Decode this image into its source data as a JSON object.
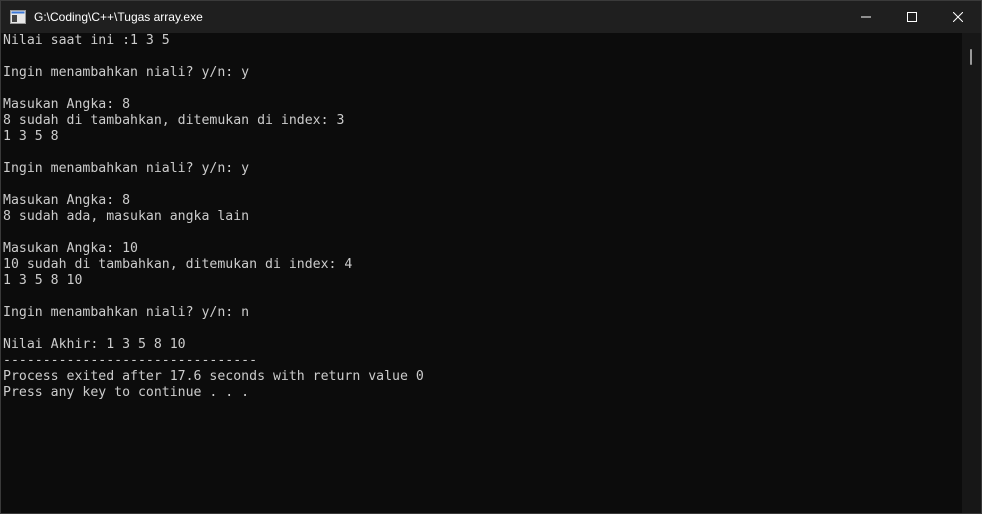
{
  "window": {
    "title": "G:\\Coding\\C++\\Tugas array.exe",
    "app_icon": "console-app-icon",
    "controls": [
      "minimize-icon",
      "maximize-icon",
      "close-icon"
    ]
  },
  "console": {
    "lines": [
      "Nilai saat ini :1 3 5",
      "",
      "Ingin menambahkan niali? y/n: y",
      "",
      "Masukan Angka: 8",
      "8 sudah di tambahkan, ditemukan di index: 3",
      "1 3 5 8",
      "",
      "Ingin menambahkan niali? y/n: y",
      "",
      "Masukan Angka: 8",
      "8 sudah ada, masukan angka lain",
      "",
      "Masukan Angka: 10",
      "10 sudah di tambahkan, ditemukan di index: 4",
      "1 3 5 8 10",
      "",
      "Ingin menambahkan niali? y/n: n",
      "",
      "Nilai Akhir: 1 3 5 8 10",
      "--------------------------------",
      "Process exited after 17.6 seconds with return value 0",
      "Press any key to continue . . ."
    ]
  },
  "colors": {
    "background": "#0c0c0c",
    "titlebar": "#1f1f1f",
    "text": "#cccccc"
  }
}
